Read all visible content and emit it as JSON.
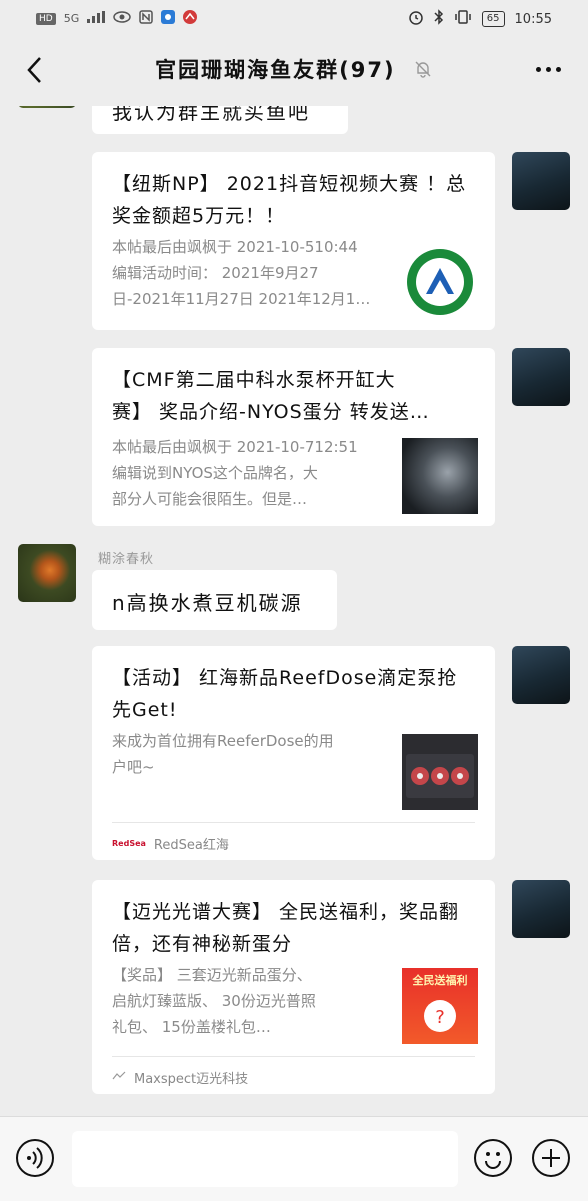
{
  "status": {
    "network": "HD",
    "signal": "5G",
    "time": "10:55",
    "battery": "65"
  },
  "header": {
    "title": "官园珊瑚海鱼友群(97)"
  },
  "messages": {
    "partial_text": "我认为群主就买鱼吧",
    "card1": {
      "title": "【纽斯NP】 2021抖音短视频大赛 ！总奖金额超5万元！！",
      "desc_line1": "本帖最后由飒枫于 2021-10-510:44",
      "desc_line2": "编辑活动时间： 2021年9月27",
      "desc_line3": "日-2021年11月27日 2021年12月1…"
    },
    "card2": {
      "title_line1": "【CMF第二届中科水泵杯开缸大",
      "title_line2": "赛】 奖品介绍-NYOS蛋分 转发送…",
      "desc_line1": "本帖最后由飒枫于 2021-10-712:51",
      "desc_line2": "编辑说到NYOS这个品牌名，大",
      "desc_line3": "部分人可能会很陌生。但是…"
    },
    "other_sender": "糊涂春秋",
    "other_text": "n高换水煮豆机碳源",
    "card3": {
      "title": "【活动】 红海新品ReefDose滴定泵抢先Get!",
      "desc_line1": "来成为首位拥有ReeferDose的用",
      "desc_line2": "户吧~",
      "source": "RedSea红海",
      "source_logo": "RedSea"
    },
    "card4": {
      "title": "【迈光光谱大赛】 全民送福利，奖品翻倍，还有神秘新蛋分",
      "desc_line1": "【奖品】 三套迈光新品蛋分、",
      "desc_line2": "启航灯臻蓝版、 30份迈光普照",
      "desc_line3": "礼包、 15份盖楼礼包…",
      "source": "Maxspect迈光科技",
      "thumb_text": "全民送福利"
    }
  },
  "colors": {
    "background": "#ededed",
    "bubble": "#ffffff",
    "desc_text": "#8a8a8a"
  }
}
